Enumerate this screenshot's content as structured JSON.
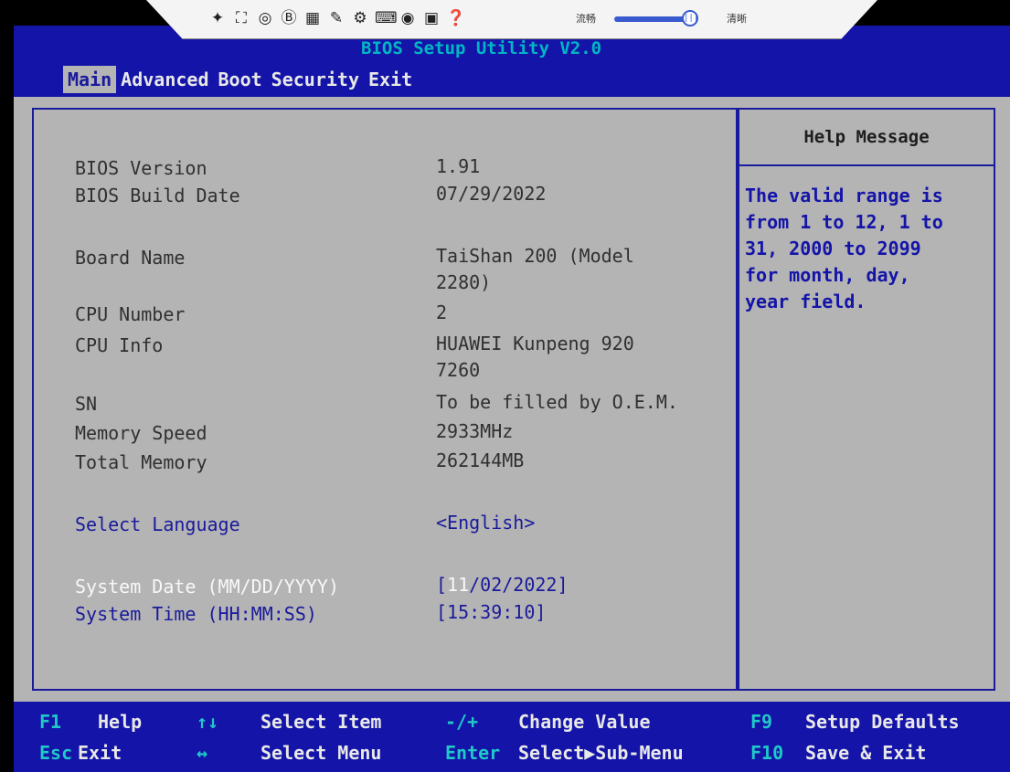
{
  "header": {
    "title": "BIOS Setup Utility V2.0",
    "tabs": [
      "Main",
      "Advanced",
      "Boot",
      "Security",
      "Exit"
    ],
    "active_tab": "Main"
  },
  "remote_toolbar": {
    "icons": [
      "pin-icon",
      "fullscreen-icon",
      "record-icon",
      "b-icon",
      "screenshot-icon",
      "paint-icon",
      "settings-icon",
      "keyboard-icon",
      "mouse-icon",
      "window-icon",
      "help-icon"
    ],
    "label_smooth": "流畅",
    "label_clear": "清晰",
    "slider_knob": "|||"
  },
  "info": {
    "bios_version_label": "BIOS Version",
    "bios_version": "1.91",
    "bios_build_date_label": "BIOS Build Date",
    "bios_build_date": "07/29/2022",
    "board_name_label": "Board Name",
    "board_name": "TaiShan 200 (Model\n2280)",
    "cpu_number_label": "CPU Number",
    "cpu_number": "2",
    "cpu_info_label": "CPU Info",
    "cpu_info": "HUAWEI Kunpeng 920\n7260",
    "sn_label": "SN",
    "sn": "To be filled by O.E.M.",
    "memory_speed_label": "Memory Speed",
    "memory_speed": "2933MHz",
    "total_memory_label": "Total Memory",
    "total_memory": "262144MB"
  },
  "settings": {
    "language_label": "Select Language",
    "language_value": "<English>",
    "date_label": "System Date (MM/DD/YYYY)",
    "date_open": "[",
    "date_month": "11",
    "date_rest": "/02/2022]",
    "time_label": "System Time (HH:MM:SS)",
    "time_value": "[15:39:10]"
  },
  "help": {
    "title": "Help Message",
    "text": "The valid range is\nfrom 1 to 12, 1 to\n31, 2000 to 2099\nfor month, day,\nyear field."
  },
  "footer": {
    "f1_key": "F1",
    "f1_desc": "Help",
    "arrows_ud_key": "↑↓",
    "arrows_ud_desc": "Select Item",
    "pm_key": "-/+",
    "pm_desc": "Change Value",
    "f9_key": "F9",
    "f9_desc": "Setup Defaults",
    "esc_key": "Esc",
    "esc_desc": "Exit",
    "arrows_lr_key": "↔",
    "arrows_lr_desc": "Select Menu",
    "enter_key": "Enter",
    "enter_desc": "Select▶Sub-Menu",
    "f10_key": "F10",
    "f10_desc": "Save & Exit"
  },
  "colors": {
    "header_bg": "#1414a8",
    "panel_bg": "#b4b4b4",
    "accent_cyan": "#20c8c8",
    "help_text": "#1414a8"
  }
}
